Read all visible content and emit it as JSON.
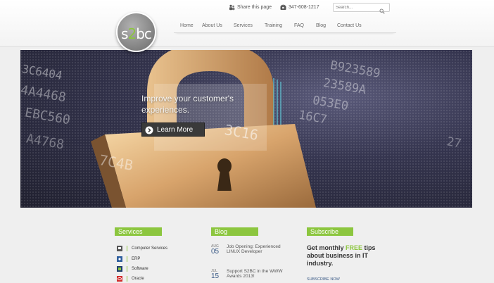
{
  "header": {
    "logo": {
      "part1": "s",
      "accent": "2",
      "part2": "bc"
    },
    "share_label": "Share this page",
    "phone": "347-608-1217",
    "search": {
      "placeholder": "Search..."
    }
  },
  "nav": {
    "items": [
      {
        "label": "Home"
      },
      {
        "label": "About Us"
      },
      {
        "label": "Services"
      },
      {
        "label": "Training"
      },
      {
        "label": "FAQ"
      },
      {
        "label": "Blog"
      },
      {
        "label": "Contact Us"
      }
    ]
  },
  "hero": {
    "headline": "Improve your customer's experiences.",
    "button_label": "Learn More",
    "bg_codes": [
      "3C6404",
      "4A4468",
      "EBC560",
      "A4768",
      "7C4B",
      "3C16",
      "B923589",
      "23589A",
      "053E0",
      "16C7",
      "27"
    ]
  },
  "services": {
    "heading": "Services",
    "items": [
      {
        "label": "Computer Services",
        "icon": "computer-icon"
      },
      {
        "label": "ERP",
        "icon": "erp-icon"
      },
      {
        "label": "Software",
        "icon": "software-icon"
      },
      {
        "label": "Oracle",
        "icon": "oracle-icon"
      }
    ]
  },
  "blog": {
    "heading": "Blog",
    "posts": [
      {
        "month": "AUG",
        "day": "05",
        "title": "Job Opening: Experienced LINUX Developer"
      },
      {
        "month": "JUL",
        "day": "15",
        "title": "Support S2BC in the WWW Awards 2013!"
      }
    ]
  },
  "subscribe": {
    "heading": "Subscribe",
    "text_before": "Get monthly ",
    "text_free": "FREE",
    "text_after": " tips about business in IT industry.",
    "link": "SUBSCRIBE NOW"
  },
  "colors": {
    "accent": "#8cc63f",
    "blog_day": "#3a5a86",
    "page_bg": "#efefef"
  }
}
